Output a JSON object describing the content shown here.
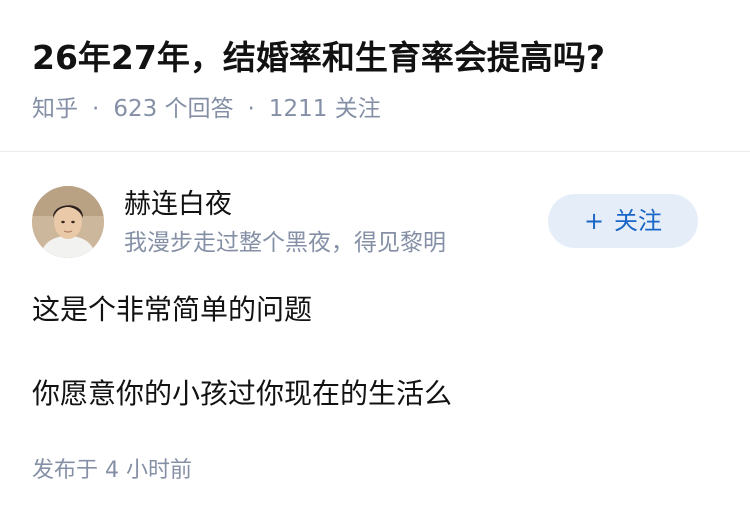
{
  "question": {
    "title": "26年27年，结婚率和生育率会提高吗?",
    "source": "知乎",
    "separator": "·",
    "answers": "623 个回答",
    "followers": "1211 关注"
  },
  "author": {
    "name": "赫连白夜",
    "bio": "我漫步走过整个黑夜，得见黎明",
    "follow_plus": "+",
    "follow_label": "关注"
  },
  "answer": {
    "paragraphs": [
      "这是个非常简单的问题",
      "你愿意你的小孩过你现在的生活么"
    ],
    "publish_time": "发布于 4 小时前"
  },
  "colors": {
    "meta_gray": "#8590a6",
    "follow_bg": "#e5eef8",
    "follow_text": "#1a66c7"
  }
}
